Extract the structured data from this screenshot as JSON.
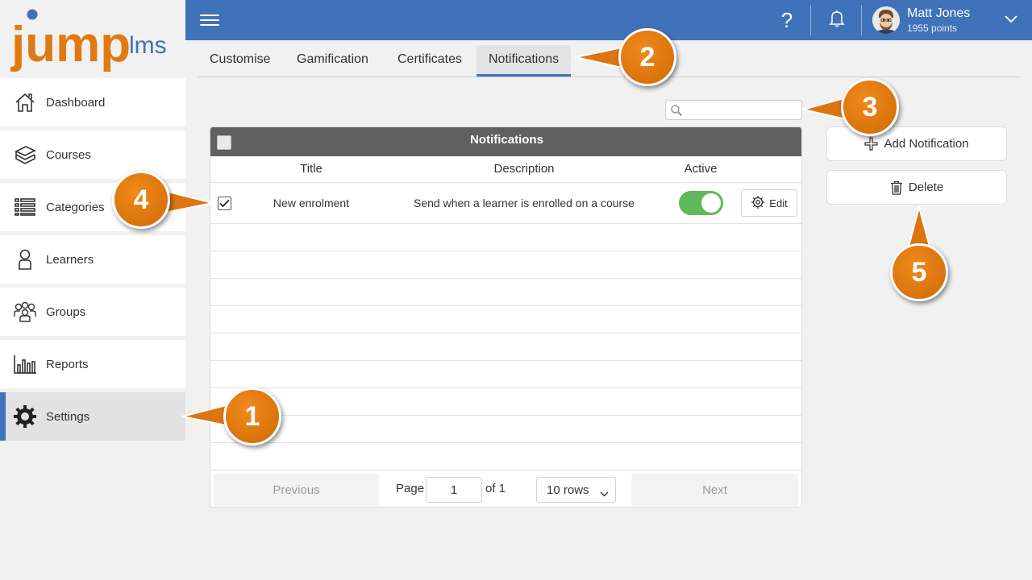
{
  "app": {
    "logo_main": "jump",
    "logo_suffix": "lms"
  },
  "sidebar": {
    "items": [
      {
        "label": "Dashboard",
        "icon": "home-icon"
      },
      {
        "label": "Courses",
        "icon": "books-icon"
      },
      {
        "label": "Categories",
        "icon": "list-icon"
      },
      {
        "label": "Learners",
        "icon": "person-icon"
      },
      {
        "label": "Groups",
        "icon": "group-icon"
      },
      {
        "label": "Reports",
        "icon": "bar-chart-icon"
      },
      {
        "label": "Settings",
        "icon": "gear-icon",
        "active": true
      }
    ]
  },
  "header": {
    "user_name": "Matt Jones",
    "user_points": "1955 points",
    "help_symbol": "?"
  },
  "tabs": [
    {
      "label": "Customise"
    },
    {
      "label": "Gamification"
    },
    {
      "label": "Certificates"
    },
    {
      "label": "Notifications",
      "active": true
    }
  ],
  "search": {
    "value": "",
    "placeholder": ""
  },
  "table": {
    "title": "Notifications",
    "columns": [
      "Title",
      "Description",
      "Active"
    ],
    "rows": [
      {
        "title": "New enrolment",
        "description": "Send when a learner is enrolled on a course",
        "active": true,
        "checked": true,
        "edit_label": "Edit"
      }
    ]
  },
  "pager": {
    "previous_label": "Previous",
    "page_label": "Page",
    "page_value": "1",
    "of_label": "of 1",
    "rows_label": "10 rows",
    "next_label": "Next"
  },
  "actions": {
    "add_label": "Add Notification",
    "delete_label": "Delete"
  },
  "callouts": [
    "1",
    "2",
    "3",
    "4",
    "5"
  ],
  "colors": {
    "topbar": "#3f72b8",
    "accent_orange": "#e07a10",
    "toggle_on": "#5fba5b",
    "table_header": "#606060"
  }
}
